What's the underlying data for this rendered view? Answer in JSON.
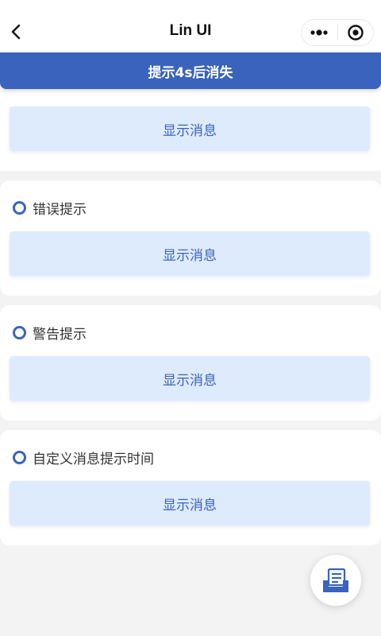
{
  "nav": {
    "title": "Lin UI"
  },
  "toast": {
    "text": "提示4s后消失"
  },
  "sections": [
    {
      "label": "",
      "button_label": "显示消息"
    },
    {
      "label": "错误提示",
      "button_label": "显示消息"
    },
    {
      "label": "警告提示",
      "button_label": "显示消息"
    },
    {
      "label": "自定义消息提示时间",
      "button_label": "显示消息"
    }
  ],
  "colors": {
    "accent": "#3963bc",
    "button_bg": "#deebfd",
    "page_bg": "#f3f3f3"
  },
  "icons": {
    "back": "chevron-left-icon",
    "more": "more-dots-icon",
    "close": "target-circle-icon",
    "fab": "document-tray-icon"
  }
}
